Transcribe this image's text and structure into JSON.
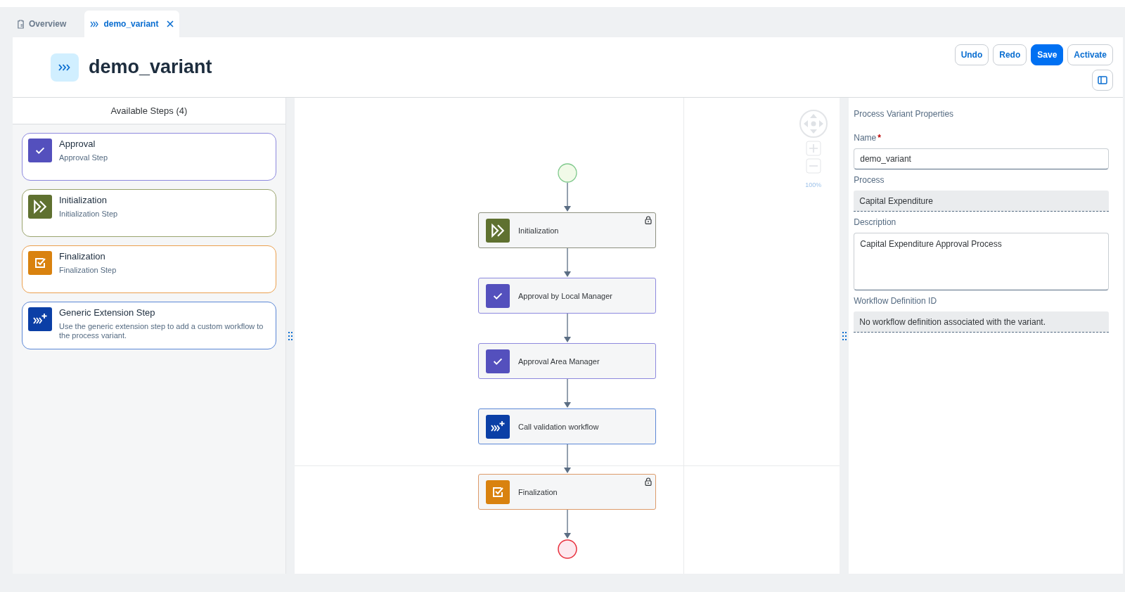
{
  "tabs": [
    {
      "label": "Overview",
      "kind": "overview",
      "selected": false,
      "closable": false
    },
    {
      "label": "demo_variant",
      "kind": "variant",
      "selected": true,
      "closable": true
    }
  ],
  "header": {
    "title": "demo_variant"
  },
  "toolbar": [
    {
      "label": "Undo",
      "emphasized": false
    },
    {
      "label": "Redo",
      "emphasized": false
    },
    {
      "label": "Save",
      "emphasized": true
    },
    {
      "label": "Activate",
      "emphasized": false
    }
  ],
  "available_steps": {
    "title": "Available Steps (4)",
    "items": [
      {
        "kind": "approval",
        "title": "Approval",
        "description": "Approval Step"
      },
      {
        "kind": "initialization",
        "title": "Initialization",
        "description": "Initialization Step"
      },
      {
        "kind": "finalization",
        "title": "Finalization",
        "description": "Finalization Step"
      },
      {
        "kind": "extension",
        "title": "Generic Extension Step",
        "description": "Use the generic extension step to add a custom workflow to the process variant."
      }
    ]
  },
  "canvas": {
    "zoom": "100%",
    "nodes": [
      {
        "kind": "initialization",
        "label": "Initialization",
        "locked": true
      },
      {
        "kind": "approval",
        "label": "Approval by Local Manager",
        "locked": false
      },
      {
        "kind": "approval",
        "label": "Approval Area Manager",
        "locked": false
      },
      {
        "kind": "extension",
        "label": "Call validation workflow",
        "locked": false
      },
      {
        "kind": "finalization",
        "label": "Finalization",
        "locked": true
      }
    ]
  },
  "properties": {
    "title": "Process Variant Properties",
    "fields": [
      {
        "kind": "input",
        "label": "Name",
        "required_mark": "*",
        "value": "demo_variant"
      },
      {
        "kind": "readonly",
        "label": "Process",
        "value": "Capital Expenditure"
      },
      {
        "kind": "textarea",
        "label": "Description",
        "value": "Capital Expenditure Approval Process"
      },
      {
        "kind": "readonly",
        "label": "Workflow Definition ID",
        "value": "No workflow definition associated with the variant."
      }
    ]
  }
}
